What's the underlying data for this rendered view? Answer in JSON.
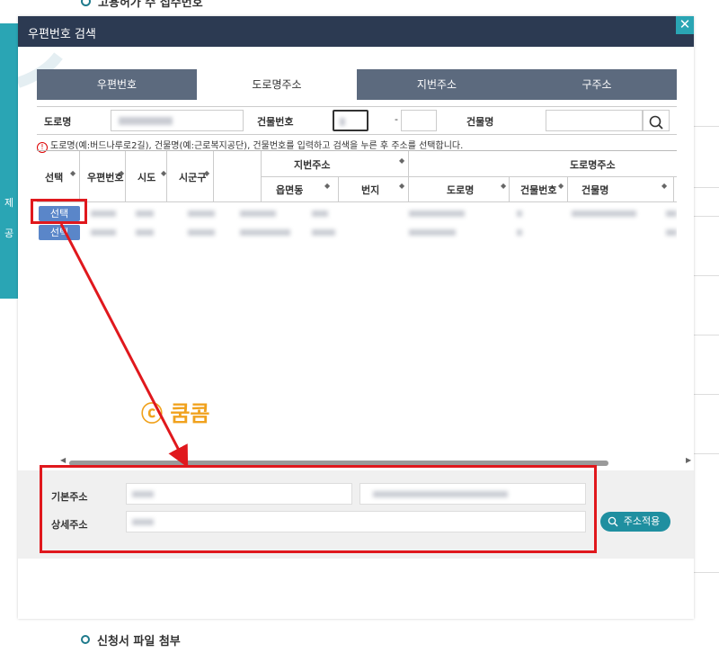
{
  "background": {
    "top_header": "고용허가 수 접수번호",
    "left_tab_label": "제공",
    "bottom_section": "신청서 파일 첨부"
  },
  "modal": {
    "title": "우편번호 검색",
    "close_icon": "close-icon"
  },
  "tabs": [
    "우편번호",
    "도로명주소",
    "지번주소",
    "구주소"
  ],
  "active_tab": "도로명주소",
  "search": {
    "road_label": "도로명",
    "building_no_label": "건물번호",
    "building_no_dash": "-",
    "building_name_label": "건물명",
    "search_icon": "search-icon"
  },
  "notice": "도로명(예:버드나루로2길), 건물명(예:근로복지공단), 건물번호를 입력하고 검색을 누른 후 주소를 선택합니다.",
  "grid": {
    "headers": {
      "select": "선택",
      "postcode": "우편번호",
      "sido": "시도",
      "sigungu": "시군구",
      "jibun_group": "지번주소",
      "eupmyeondong": "읍면동",
      "bunji": "번지",
      "road_group": "도로명주소",
      "road_name": "도로명",
      "building_no": "건물번호",
      "building_name": "건물명"
    },
    "row_button_label": "선택"
  },
  "watermark": "ⓒ 쿰콤",
  "address": {
    "basic_label": "기본주소",
    "detail_label": "상세주소",
    "apply_button": "주소적용"
  },
  "colors": {
    "modal_header": "#2c3a52",
    "tab_bar": "#5c6a7e",
    "accent": "#2aa5b4",
    "select_button": "#5a86c9",
    "highlight": "#e0181d",
    "watermark": "#f0a21e"
  }
}
